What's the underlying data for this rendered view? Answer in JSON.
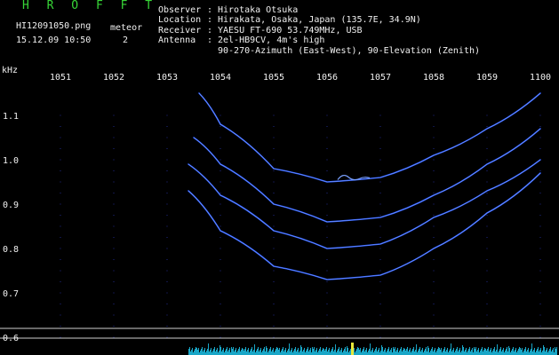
{
  "app_title": "H R O F F T",
  "file_name": "HI12091050.png",
  "datetime": "15.12.09 10:50",
  "meteor": {
    "label": "meteor",
    "count": "2"
  },
  "info": [
    {
      "key": "Observer",
      "value": "Hirotaka Otsuka"
    },
    {
      "key": "Location",
      "value": "Hirakata, Osaka, Japan (135.7E, 34.9N)"
    },
    {
      "key": "Receiver",
      "value": "YAESU FT-690 53.749MHz, USB"
    },
    {
      "key": "Antenna",
      "value": "2el-HB9CV, 4m's high"
    }
  ],
  "antenna_line2": "90-270-Azimuth (East-West), 90-Elevation (Zenith)",
  "y_unit": "kHz",
  "time_labels": [
    "1051",
    "1052",
    "1053",
    "1054",
    "1055",
    "1056",
    "1057",
    "1058",
    "1059",
    "1100"
  ],
  "freq_labels": [
    "1.1",
    "1.0",
    "0.9",
    "0.8",
    "0.7",
    "0.6"
  ],
  "colors": {
    "title": "#37d637",
    "trace": "#2a5cff",
    "signal_bar": "#19a6c7",
    "grid_dot": "#1f2a8c"
  },
  "chart_data": {
    "type": "line",
    "xlabel": "",
    "ylabel": "kHz",
    "x_ticks": [
      "1051",
      "1052",
      "1053",
      "1054",
      "1055",
      "1056",
      "1057",
      "1058",
      "1059",
      "1100"
    ],
    "y_ticks": [
      1.1,
      1.0,
      0.9,
      0.8,
      0.7,
      0.6
    ],
    "ylim": [
      0.58,
      1.18
    ],
    "series": [
      {
        "x": [
          "1053.6",
          "1054",
          "1055",
          "1056",
          "1057",
          "1058",
          "1059",
          "1100"
        ],
        "y": [
          1.15,
          1.08,
          0.98,
          0.95,
          0.96,
          1.01,
          1.07,
          1.15
        ]
      },
      {
        "x": [
          "1053.5",
          "1054",
          "1055",
          "1056",
          "1057",
          "1058",
          "1059",
          "1100"
        ],
        "y": [
          1.05,
          0.99,
          0.9,
          0.86,
          0.87,
          0.92,
          0.99,
          1.07
        ]
      },
      {
        "x": [
          "1053.4",
          "1054",
          "1055",
          "1056",
          "1057",
          "1058",
          "1059",
          "1100"
        ],
        "y": [
          0.99,
          0.92,
          0.84,
          0.8,
          0.81,
          0.87,
          0.93,
          1.0
        ]
      },
      {
        "x": [
          "1053.4",
          "1054",
          "1055",
          "1056",
          "1057",
          "1058",
          "1059",
          "1100"
        ],
        "y": [
          0.93,
          0.84,
          0.76,
          0.73,
          0.74,
          0.8,
          0.88,
          0.97
        ]
      }
    ]
  }
}
